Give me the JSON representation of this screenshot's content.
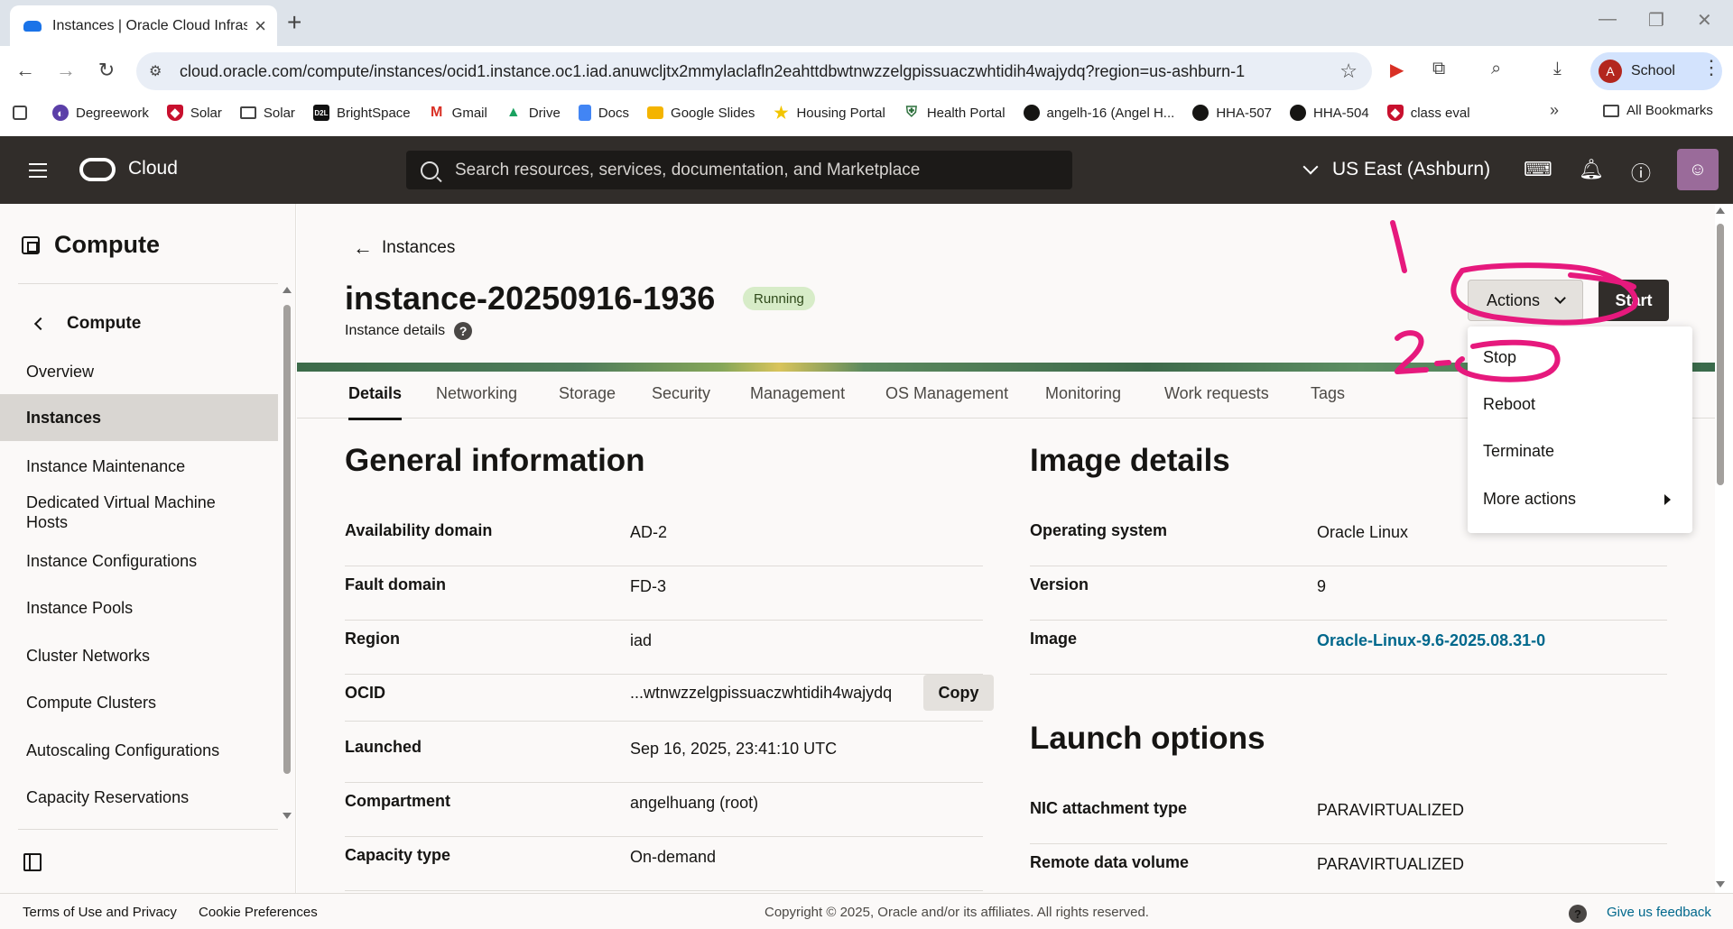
{
  "browser": {
    "tab_title": "Instances | Oracle Cloud Infrastru",
    "url": "cloud.oracle.com/compute/instances/ocid1.instance.oc1.iad.anuwcljtx2mmylaclafln2eahttdbwtnwzzelgpissuaczwhtidih4wajydq?region=us-ashburn-1",
    "profile_initial": "A",
    "profile_name": "School",
    "bookmarks": [
      "Degreework",
      "Solar",
      "Solar",
      "BrightSpace",
      "Gmail",
      "Drive",
      "Docs",
      "Google Slides",
      "Housing Portal",
      "Health Portal",
      "angelh-16 (Angel H...",
      "HHA-507",
      "HHA-504",
      "class eval"
    ],
    "all_bookmarks": "All Bookmarks",
    "bookmark_icons": {
      "d2l": "D2L"
    }
  },
  "header": {
    "brand": "Cloud",
    "search_placeholder": "Search resources, services, documentation, and Marketplace",
    "region": "US East (Ashburn)"
  },
  "sidebar": {
    "heading": "Compute",
    "back_label": "Compute",
    "items": [
      "Overview",
      "Instances",
      "Instance Maintenance",
      "Dedicated Virtual Machine Hosts",
      "Instance Configurations",
      "Instance Pools",
      "Cluster Networks",
      "Compute Clusters",
      "Autoscaling Configurations",
      "Capacity Reservations"
    ],
    "active_item": "Instances"
  },
  "page": {
    "back_link": "Instances",
    "title": "instance-20250916-1936",
    "status": "Running",
    "subtitle": "Instance details",
    "actions_label": "Actions",
    "start_label": "Start",
    "tabs": [
      "Details",
      "Networking",
      "Storage",
      "Security",
      "Management",
      "OS Management",
      "Monitoring",
      "Work requests",
      "Tags"
    ],
    "active_tab": "Details"
  },
  "general_info": {
    "title": "General information",
    "rows": [
      {
        "key": "Availability domain",
        "value": "AD-2"
      },
      {
        "key": "Fault domain",
        "value": "FD-3"
      },
      {
        "key": "Region",
        "value": "iad"
      },
      {
        "key": "OCID",
        "value": "...wtnwzzelgpissuaczwhtidih4wajydq"
      },
      {
        "key": "Launched",
        "value": "Sep 16, 2025, 23:41:10 UTC"
      },
      {
        "key": "Compartment",
        "value": "angelhuang (root)"
      },
      {
        "key": "Capacity type",
        "value": "On-demand"
      }
    ],
    "copy_label": "Copy"
  },
  "image_details": {
    "title": "Image details",
    "rows": [
      {
        "key": "Operating system",
        "value": "Oracle Linux"
      },
      {
        "key": "Version",
        "value": "9"
      },
      {
        "key": "Image",
        "value": "Oracle-Linux-9.6-2025.08.31-0"
      }
    ]
  },
  "launch_options": {
    "title": "Launch options",
    "rows": [
      {
        "key": "NIC attachment type",
        "value": "PARAVIRTUALIZED"
      },
      {
        "key": "Remote data volume",
        "value": "PARAVIRTUALIZED"
      }
    ]
  },
  "actions_menu": {
    "items": [
      "Stop",
      "Reboot",
      "Terminate",
      "More actions"
    ]
  },
  "footer": {
    "terms": "Terms of Use and Privacy",
    "cookies": "Cookie Preferences",
    "copyright": "Copyright © 2025, Oracle and/or its affiliates. All rights reserved.",
    "feedback": "Give us feedback"
  },
  "annotations": {
    "color": "#e6197d",
    "labels": [
      "1",
      "2"
    ]
  }
}
